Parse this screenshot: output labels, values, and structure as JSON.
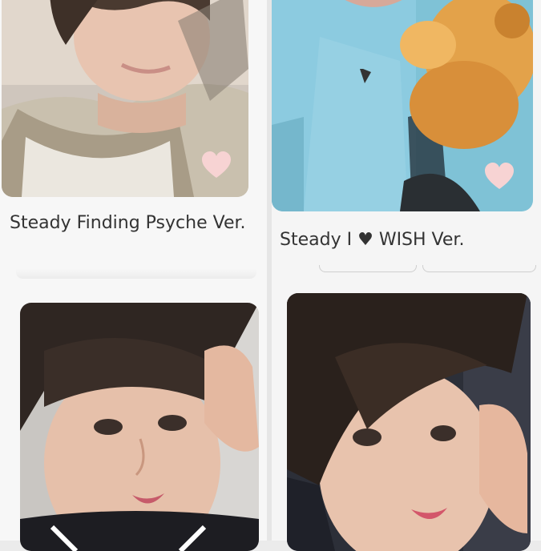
{
  "cards": [
    {
      "title": "Steady Finding Psyche Ver.",
      "liked": false
    },
    {
      "title_before": "Steady I",
      "title_after": "WISH Ver.",
      "liked": false
    },
    {
      "title": "",
      "liked": false
    },
    {
      "title": "",
      "liked": false
    }
  ],
  "colors": {
    "heart": "#f7d3d3",
    "title_text": "#333333",
    "background": "#f7f7f7"
  },
  "icons": {
    "favorite": "heart-outline-icon",
    "title_heart": "heart-glyph-icon"
  }
}
